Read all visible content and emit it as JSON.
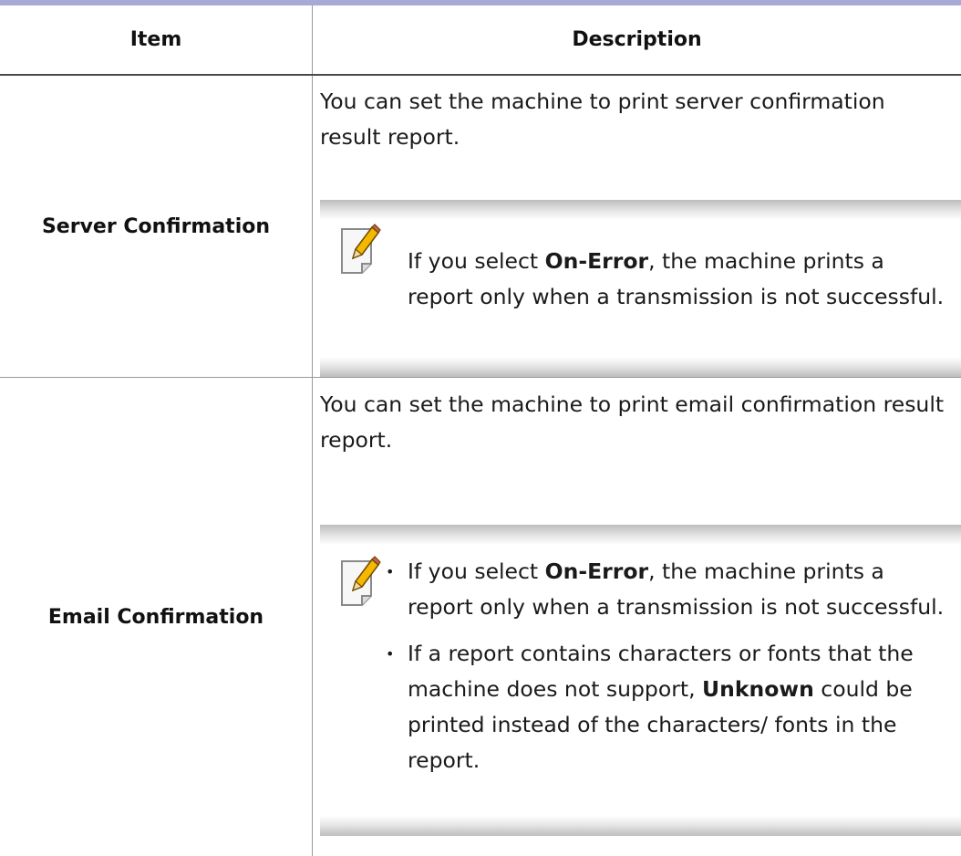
{
  "table": {
    "header": {
      "item": "Item",
      "description": "Description"
    },
    "rows": [
      {
        "item": "Server Confirmation",
        "description": "You can set the machine to print server confirmation result report.",
        "note": {
          "icon": "note-pencil-icon",
          "text_before": "If you select ",
          "bold": "On-Error",
          "text_after": ", the machine prints a report only when a transmission is not successful."
        }
      },
      {
        "item": "Email Confirmation",
        "description": "You can set the machine to print email confirmation result report.",
        "note": {
          "icon": "note-pencil-icon",
          "bullets": [
            {
              "text_before": "If you select ",
              "bold": "On-Error",
              "text_after": ", the machine prints a report only when a transmission is not successful."
            },
            {
              "text_before": "If a report contains characters or fonts that the machine does not support, ",
              "bold": "Unknown",
              "text_after": " could be printed instead of the characters/ fonts in the report."
            }
          ]
        }
      }
    ]
  },
  "colors": {
    "top_rule": "#a7a9d6",
    "text": "#1a1a1a",
    "divider": "#9a9a9a"
  }
}
